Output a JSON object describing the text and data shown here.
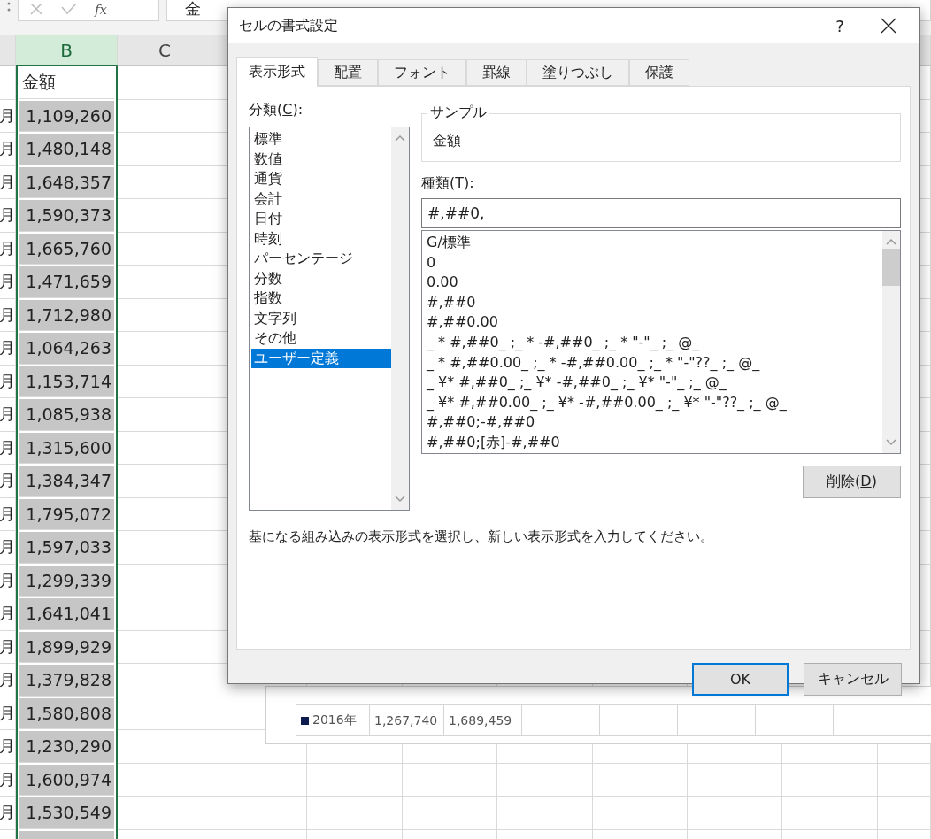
{
  "formula_bar": {
    "fx_label": "fx",
    "value": "金"
  },
  "columns": [
    {
      "label": "B",
      "selected": true
    },
    {
      "label": "C",
      "selected": false
    }
  ],
  "rows": [
    {
      "month": "",
      "amount": "金額",
      "active": true
    },
    {
      "month": "月",
      "amount": "1,109,260",
      "active": false
    },
    {
      "month": "月",
      "amount": "1,480,148",
      "active": false
    },
    {
      "month": "月",
      "amount": "1,648,357",
      "active": false
    },
    {
      "month": "月",
      "amount": "1,590,373",
      "active": false
    },
    {
      "month": "月",
      "amount": "1,665,760",
      "active": false
    },
    {
      "month": "月",
      "amount": "1,471,659",
      "active": false
    },
    {
      "month": "月",
      "amount": "1,712,980",
      "active": false
    },
    {
      "month": "月",
      "amount": "1,064,263",
      "active": false
    },
    {
      "month": "月",
      "amount": "1,153,714",
      "active": false
    },
    {
      "month": "月",
      "amount": "1,085,938",
      "active": false
    },
    {
      "month": "月",
      "amount": "1,315,600",
      "active": false
    },
    {
      "month": "月",
      "amount": "1,384,347",
      "active": false
    },
    {
      "month": "月",
      "amount": "1,795,072",
      "active": false
    },
    {
      "month": "月",
      "amount": "1,597,033",
      "active": false
    },
    {
      "month": "月",
      "amount": "1,299,339",
      "active": false
    },
    {
      "month": "月",
      "amount": "1,641,041",
      "active": false
    },
    {
      "month": "月",
      "amount": "1,899,929",
      "active": false
    },
    {
      "month": "月",
      "amount": "1,379,828",
      "active": false
    },
    {
      "month": "月",
      "amount": "1,580,808",
      "active": false
    },
    {
      "month": "月",
      "amount": "1,230,290",
      "active": false
    },
    {
      "month": "月",
      "amount": "1,600,974",
      "active": false
    },
    {
      "month": "月",
      "amount": "1,530,549",
      "active": false
    }
  ],
  "chart_table": {
    "series": "2016年",
    "color": "#0d1b4f",
    "values": [
      "1,267,740",
      "1,689,459"
    ]
  },
  "dialog": {
    "title": "セルの書式設定",
    "help": "?",
    "tabs": [
      {
        "label": "表示形式",
        "selected": true
      },
      {
        "label": "配置",
        "selected": false
      },
      {
        "label": "フォント",
        "selected": false
      },
      {
        "label": "罫線",
        "selected": false
      },
      {
        "label": "塗りつぶし",
        "selected": false
      },
      {
        "label": "保護",
        "selected": false
      }
    ],
    "category": {
      "label": "分類(C):",
      "items": [
        {
          "label": "標準",
          "selected": false
        },
        {
          "label": "数値",
          "selected": false
        },
        {
          "label": "通貨",
          "selected": false
        },
        {
          "label": "会計",
          "selected": false
        },
        {
          "label": "日付",
          "selected": false
        },
        {
          "label": "時刻",
          "selected": false
        },
        {
          "label": "パーセンテージ",
          "selected": false
        },
        {
          "label": "分数",
          "selected": false
        },
        {
          "label": "指数",
          "selected": false
        },
        {
          "label": "文字列",
          "selected": false
        },
        {
          "label": "その他",
          "selected": false
        },
        {
          "label": "ユーザー定義",
          "selected": true
        }
      ]
    },
    "sample": {
      "legend": "サンプル",
      "value": "金額"
    },
    "type": {
      "label": "種類(T):",
      "value": "#,##0,",
      "items": [
        "G/標準",
        "0",
        "0.00",
        "#,##0",
        "#,##0.00",
        "_ * #,##0_ ;_ * -#,##0_ ;_ * \"-\"_ ;_ @_",
        "_ * #,##0.00_ ;_ * -#,##0.00_ ;_ * \"-\"??_ ;_ @_",
        "_ ¥* #,##0_ ;_ ¥* -#,##0_ ;_ ¥* \"-\"_ ;_ @_",
        "_ ¥* #,##0.00_ ;_ ¥* -#,##0.00_ ;_ ¥* \"-\"??_ ;_ @_",
        "#,##0;-#,##0",
        "#,##0;[赤]-#,##0"
      ]
    },
    "delete_button": {
      "label": "削除(D)"
    },
    "description": "基になる組み込みの表示形式を選択し、新しい表示形式を入力してください。",
    "buttons": [
      {
        "label": "OK",
        "default": true
      },
      {
        "label": "キャンセル",
        "default": false
      }
    ]
  }
}
